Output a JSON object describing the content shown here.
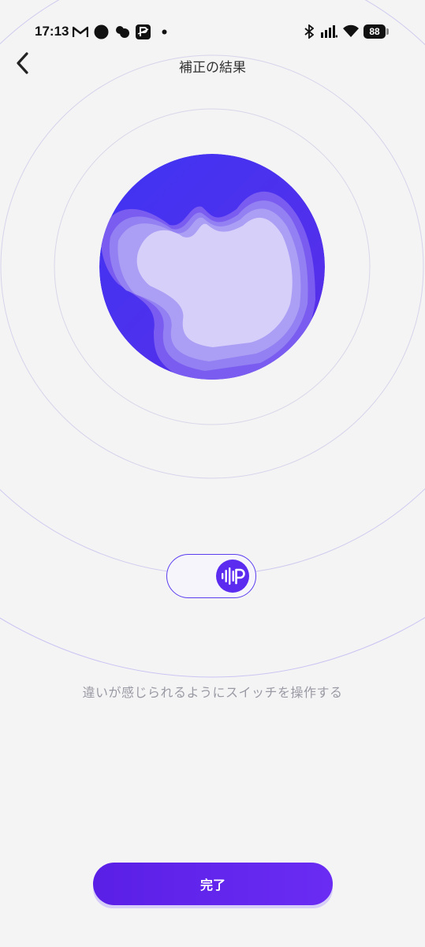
{
  "status_bar": {
    "time": "17:13",
    "battery": "88",
    "icons": [
      "gmail-icon",
      "circle-icon",
      "cloud-chat-icon",
      "paypay-icon",
      "dot-icon",
      "bluetooth-icon",
      "signal-icon",
      "wifi-icon",
      "battery-icon"
    ]
  },
  "header": {
    "title": "補正の結果",
    "back_icon": "chevron-left-icon"
  },
  "visual": {
    "primary_color": "#4a35f0",
    "accent_color": "#5b2cf0",
    "toggle_state": "on",
    "toggle_icon": "audio-wave-p-icon"
  },
  "instruction": "違いが感じられるようにスイッチを操作する",
  "done_button": "完了"
}
